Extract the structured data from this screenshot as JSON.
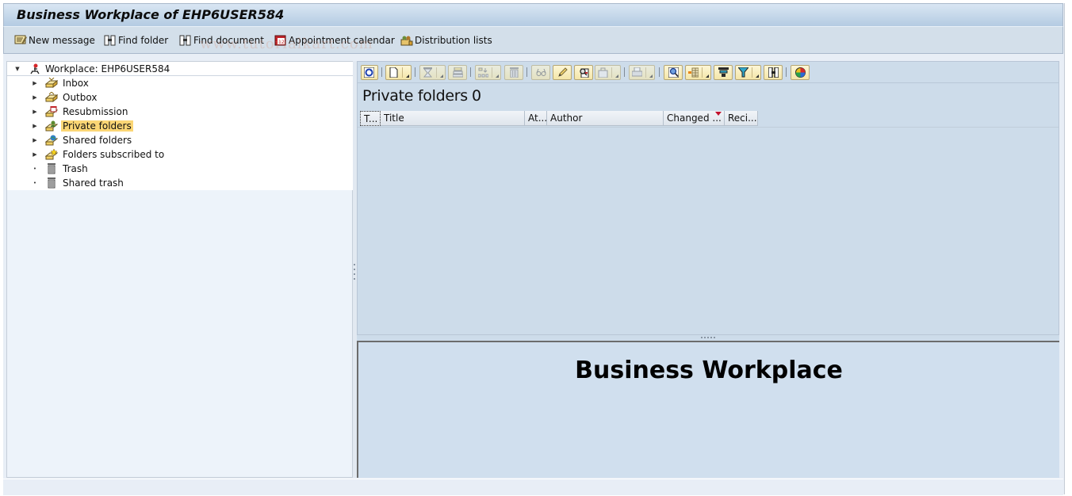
{
  "window": {
    "title": "Business Workplace of EHP6USER584"
  },
  "app_toolbar": {
    "buttons": [
      {
        "label": "New message",
        "icon": "new-message-icon"
      },
      {
        "label": "Find folder",
        "icon": "binoculars-icon"
      },
      {
        "label": "Find document",
        "icon": "binoculars-icon"
      },
      {
        "label": "Appointment calendar",
        "icon": "calendar-icon"
      },
      {
        "label": "Distribution lists",
        "icon": "distribution-list-icon"
      }
    ]
  },
  "watermark": "www.tutorialkart.com",
  "tree": {
    "root": {
      "label": "Workplace: EHP6USER584",
      "expanded": true,
      "icon": "workplace-chair-icon"
    },
    "items": [
      {
        "label": "Inbox",
        "icon": "inbox-tray-icon",
        "expandable": true,
        "selected": false
      },
      {
        "label": "Outbox",
        "icon": "outbox-tray-icon",
        "expandable": true,
        "selected": false
      },
      {
        "label": "Resubmission",
        "icon": "resubmission-icon",
        "expandable": true,
        "selected": false
      },
      {
        "label": "Private folders",
        "icon": "private-folders-icon",
        "expandable": true,
        "selected": true
      },
      {
        "label": "Shared folders",
        "icon": "shared-folders-icon",
        "expandable": true,
        "selected": false
      },
      {
        "label": "Folders subscribed to",
        "icon": "subscribed-folders-icon",
        "expandable": true,
        "selected": false
      },
      {
        "label": "Trash",
        "icon": "trash-icon",
        "expandable": false,
        "selected": false
      },
      {
        "label": "Shared trash",
        "icon": "trash-icon",
        "expandable": false,
        "selected": false
      }
    ]
  },
  "list_toolbar": {
    "buttons": [
      {
        "name": "refresh",
        "icon": "refresh-icon",
        "enabled": true
      },
      {
        "name": "create-document",
        "icon": "new-document-icon",
        "enabled": true,
        "dropdown": true
      },
      {
        "name": "execute",
        "icon": "hourglass-icon",
        "enabled": false,
        "dropdown": true
      },
      {
        "name": "stack",
        "icon": "stack-icon",
        "enabled": false
      },
      {
        "name": "move",
        "icon": "move-icon",
        "enabled": false,
        "dropdown": true
      },
      {
        "name": "delete",
        "icon": "delete-icon",
        "enabled": false
      },
      {
        "name": "display",
        "icon": "glasses-icon",
        "enabled": false
      },
      {
        "name": "change",
        "icon": "pencil-icon",
        "enabled": false
      },
      {
        "name": "find-document",
        "icon": "find-document-icon",
        "enabled": true
      },
      {
        "name": "attachment",
        "icon": "bag-icon",
        "enabled": false,
        "dropdown": true
      },
      {
        "name": "print",
        "icon": "print-icon",
        "enabled": false,
        "dropdown": true
      },
      {
        "name": "details",
        "icon": "details-magnifier-icon",
        "enabled": true
      },
      {
        "name": "layout",
        "icon": "layout-icon",
        "enabled": true,
        "dropdown": true
      },
      {
        "name": "sort",
        "icon": "sort-icon",
        "enabled": true
      },
      {
        "name": "filter",
        "icon": "filter-icon",
        "enabled": true,
        "dropdown": true
      },
      {
        "name": "find",
        "icon": "binoculars-icon",
        "enabled": true
      },
      {
        "name": "graphic",
        "icon": "color-wheel-icon",
        "enabled": true
      }
    ]
  },
  "list": {
    "title": "Private folders",
    "count": "0",
    "columns": [
      {
        "label": "T..."
      },
      {
        "label": "Title"
      },
      {
        "label": "At..."
      },
      {
        "label": "Author"
      },
      {
        "label": "Changed ...",
        "sorted": "descending"
      },
      {
        "label": "Reci..."
      }
    ],
    "rows": []
  },
  "preview": {
    "title": "Business Workplace"
  }
}
